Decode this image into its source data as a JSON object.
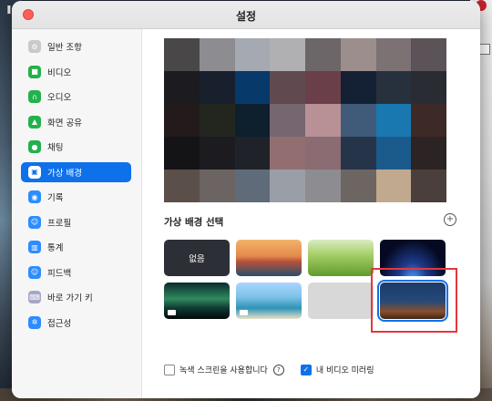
{
  "window": {
    "title": "설정"
  },
  "sidebar": {
    "items": [
      {
        "label": "일반 조항",
        "icon": "gear-icon",
        "color": "#c9c9c9",
        "active": false
      },
      {
        "label": "비디오",
        "icon": "video-icon",
        "color": "#22b14c",
        "active": false
      },
      {
        "label": "오디오",
        "icon": "headphones-icon",
        "color": "#22b14c",
        "active": false
      },
      {
        "label": "화면 공유",
        "icon": "screen-share-icon",
        "color": "#22b14c",
        "active": false
      },
      {
        "label": "채팅",
        "icon": "chat-icon",
        "color": "#22b14c",
        "active": false
      },
      {
        "label": "가상 배경",
        "icon": "virtual-background-icon",
        "color": "#0e71eb",
        "active": true
      },
      {
        "label": "기록",
        "icon": "record-icon",
        "color": "#2d8cff",
        "active": false
      },
      {
        "label": "프로필",
        "icon": "profile-icon",
        "color": "#2d8cff",
        "active": false
      },
      {
        "label": "통계",
        "icon": "statistics-icon",
        "color": "#2d8cff",
        "active": false
      },
      {
        "label": "피드백",
        "icon": "feedback-icon",
        "color": "#2d8cff",
        "active": false
      },
      {
        "label": "바로 가기 키",
        "icon": "keyboard-icon",
        "color": "#a6a6c8",
        "active": false
      },
      {
        "label": "접근성",
        "icon": "accessibility-icon",
        "color": "#2d8cff",
        "active": false
      }
    ]
  },
  "main": {
    "section_title": "가상 배경 선택",
    "thumbnails": [
      {
        "label": "없음",
        "kind": "none"
      },
      {
        "label": "",
        "kind": "golden-gate-bridge"
      },
      {
        "label": "",
        "kind": "grass"
      },
      {
        "label": "",
        "kind": "earth-space"
      },
      {
        "label": "",
        "kind": "aurora",
        "video": true
      },
      {
        "label": "",
        "kind": "beach",
        "video": true
      },
      {
        "label": "",
        "kind": "blank"
      },
      {
        "label": "",
        "kind": "room",
        "selected": true
      }
    ],
    "green_screen_label": "녹색 스크린을 사용합니다",
    "mirror_label": "내 비디오 미러링",
    "green_screen_checked": false,
    "mirror_checked": true
  },
  "colors": {
    "accent": "#0e71eb",
    "highlight": "#e2383f"
  }
}
